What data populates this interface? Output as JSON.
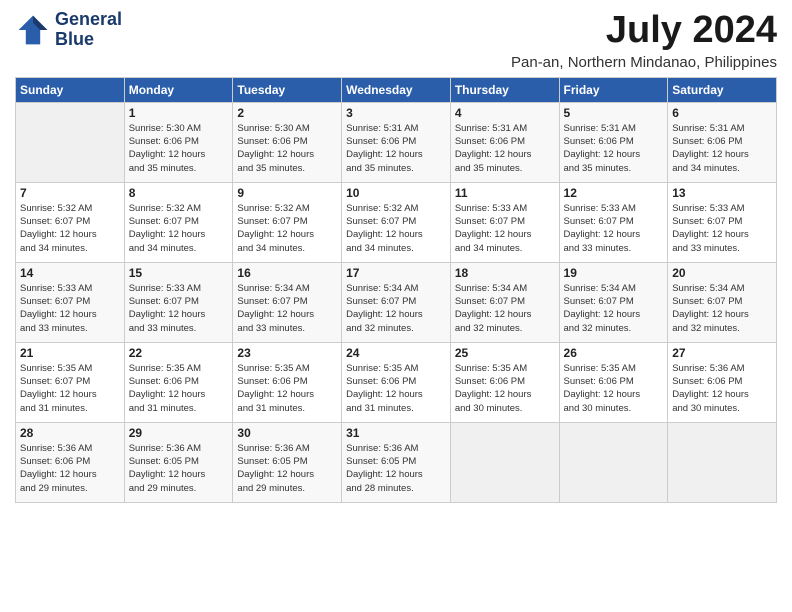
{
  "header": {
    "logo_line1": "General",
    "logo_line2": "Blue",
    "title": "July 2024",
    "location": "Pan-an, Northern Mindanao, Philippines"
  },
  "days_of_week": [
    "Sunday",
    "Monday",
    "Tuesday",
    "Wednesday",
    "Thursday",
    "Friday",
    "Saturday"
  ],
  "weeks": [
    [
      {
        "day": "",
        "text": ""
      },
      {
        "day": "1",
        "text": "Sunrise: 5:30 AM\nSunset: 6:06 PM\nDaylight: 12 hours\nand 35 minutes."
      },
      {
        "day": "2",
        "text": "Sunrise: 5:30 AM\nSunset: 6:06 PM\nDaylight: 12 hours\nand 35 minutes."
      },
      {
        "day": "3",
        "text": "Sunrise: 5:31 AM\nSunset: 6:06 PM\nDaylight: 12 hours\nand 35 minutes."
      },
      {
        "day": "4",
        "text": "Sunrise: 5:31 AM\nSunset: 6:06 PM\nDaylight: 12 hours\nand 35 minutes."
      },
      {
        "day": "5",
        "text": "Sunrise: 5:31 AM\nSunset: 6:06 PM\nDaylight: 12 hours\nand 35 minutes."
      },
      {
        "day": "6",
        "text": "Sunrise: 5:31 AM\nSunset: 6:06 PM\nDaylight: 12 hours\nand 34 minutes."
      }
    ],
    [
      {
        "day": "7",
        "text": "Sunrise: 5:32 AM\nSunset: 6:07 PM\nDaylight: 12 hours\nand 34 minutes."
      },
      {
        "day": "8",
        "text": "Sunrise: 5:32 AM\nSunset: 6:07 PM\nDaylight: 12 hours\nand 34 minutes."
      },
      {
        "day": "9",
        "text": "Sunrise: 5:32 AM\nSunset: 6:07 PM\nDaylight: 12 hours\nand 34 minutes."
      },
      {
        "day": "10",
        "text": "Sunrise: 5:32 AM\nSunset: 6:07 PM\nDaylight: 12 hours\nand 34 minutes."
      },
      {
        "day": "11",
        "text": "Sunrise: 5:33 AM\nSunset: 6:07 PM\nDaylight: 12 hours\nand 34 minutes."
      },
      {
        "day": "12",
        "text": "Sunrise: 5:33 AM\nSunset: 6:07 PM\nDaylight: 12 hours\nand 33 minutes."
      },
      {
        "day": "13",
        "text": "Sunrise: 5:33 AM\nSunset: 6:07 PM\nDaylight: 12 hours\nand 33 minutes."
      }
    ],
    [
      {
        "day": "14",
        "text": "Sunrise: 5:33 AM\nSunset: 6:07 PM\nDaylight: 12 hours\nand 33 minutes."
      },
      {
        "day": "15",
        "text": "Sunrise: 5:33 AM\nSunset: 6:07 PM\nDaylight: 12 hours\nand 33 minutes."
      },
      {
        "day": "16",
        "text": "Sunrise: 5:34 AM\nSunset: 6:07 PM\nDaylight: 12 hours\nand 33 minutes."
      },
      {
        "day": "17",
        "text": "Sunrise: 5:34 AM\nSunset: 6:07 PM\nDaylight: 12 hours\nand 32 minutes."
      },
      {
        "day": "18",
        "text": "Sunrise: 5:34 AM\nSunset: 6:07 PM\nDaylight: 12 hours\nand 32 minutes."
      },
      {
        "day": "19",
        "text": "Sunrise: 5:34 AM\nSunset: 6:07 PM\nDaylight: 12 hours\nand 32 minutes."
      },
      {
        "day": "20",
        "text": "Sunrise: 5:34 AM\nSunset: 6:07 PM\nDaylight: 12 hours\nand 32 minutes."
      }
    ],
    [
      {
        "day": "21",
        "text": "Sunrise: 5:35 AM\nSunset: 6:07 PM\nDaylight: 12 hours\nand 31 minutes."
      },
      {
        "day": "22",
        "text": "Sunrise: 5:35 AM\nSunset: 6:06 PM\nDaylight: 12 hours\nand 31 minutes."
      },
      {
        "day": "23",
        "text": "Sunrise: 5:35 AM\nSunset: 6:06 PM\nDaylight: 12 hours\nand 31 minutes."
      },
      {
        "day": "24",
        "text": "Sunrise: 5:35 AM\nSunset: 6:06 PM\nDaylight: 12 hours\nand 31 minutes."
      },
      {
        "day": "25",
        "text": "Sunrise: 5:35 AM\nSunset: 6:06 PM\nDaylight: 12 hours\nand 30 minutes."
      },
      {
        "day": "26",
        "text": "Sunrise: 5:35 AM\nSunset: 6:06 PM\nDaylight: 12 hours\nand 30 minutes."
      },
      {
        "day": "27",
        "text": "Sunrise: 5:36 AM\nSunset: 6:06 PM\nDaylight: 12 hours\nand 30 minutes."
      }
    ],
    [
      {
        "day": "28",
        "text": "Sunrise: 5:36 AM\nSunset: 6:06 PM\nDaylight: 12 hours\nand 29 minutes."
      },
      {
        "day": "29",
        "text": "Sunrise: 5:36 AM\nSunset: 6:05 PM\nDaylight: 12 hours\nand 29 minutes."
      },
      {
        "day": "30",
        "text": "Sunrise: 5:36 AM\nSunset: 6:05 PM\nDaylight: 12 hours\nand 29 minutes."
      },
      {
        "day": "31",
        "text": "Sunrise: 5:36 AM\nSunset: 6:05 PM\nDaylight: 12 hours\nand 28 minutes."
      },
      {
        "day": "",
        "text": ""
      },
      {
        "day": "",
        "text": ""
      },
      {
        "day": "",
        "text": ""
      }
    ]
  ]
}
